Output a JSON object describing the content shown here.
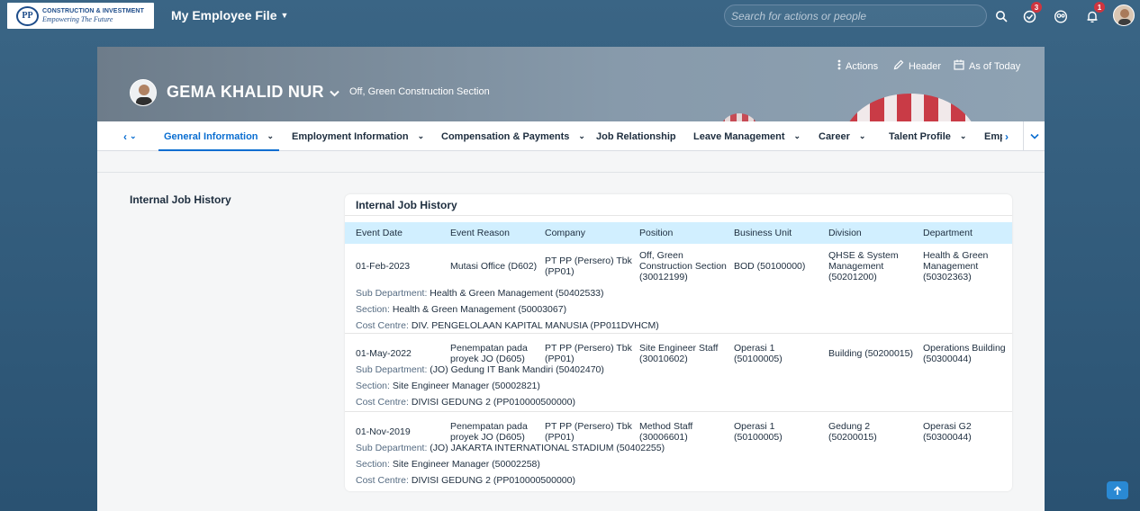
{
  "shell": {
    "logo_line1": "CONSTRUCTION & INVESTMENT",
    "logo_line2": "Empowering The Future",
    "logo_mark": "PP",
    "app_title": "My Employee File",
    "search_placeholder": "Search for actions or people",
    "tasks_badge": "3",
    "notifications_badge": "1"
  },
  "header": {
    "employee_name": "GEMA KHALID NUR",
    "position": "Off, Green Construction Section",
    "actions_label": "Actions",
    "header_label": "Header",
    "as_of_label": "As of Today"
  },
  "tabs": [
    {
      "label": "General Information",
      "active": true
    },
    {
      "label": "Employment Information"
    },
    {
      "label": "Compensation & Payments"
    },
    {
      "label": "Job Relationship"
    },
    {
      "label": "Leave Management"
    },
    {
      "label": "Career"
    },
    {
      "label": "Talent Profile"
    },
    {
      "label": "Emp"
    }
  ],
  "section": {
    "title": "Internal Job History",
    "card_title": "Internal Job History",
    "columns": [
      "Event Date",
      "Event Reason",
      "Company",
      "Position",
      "Business Unit",
      "Division",
      "Department"
    ],
    "sub_labels": {
      "sub_department": "Sub Department:",
      "section": "Section:",
      "cost_centre": "Cost Centre:"
    },
    "rows": [
      {
        "event_date": "01-Feb-2023",
        "event_reason": "Mutasi Office (D602)",
        "company": [
          "PT PP (Persero) Tbk",
          "(PP01)"
        ],
        "position": [
          "Off, Green",
          "Construction Section",
          "(30012199)"
        ],
        "business_unit": [
          "BOD (50100000)"
        ],
        "division": [
          "QHSE & System",
          "Management",
          "(50201200)"
        ],
        "department": [
          "Health & Green",
          "Management",
          "(50302363)"
        ],
        "sub_department": "Health & Green Management (50402533)",
        "section": "Health & Green Management (50003067)",
        "cost_centre": "DIV. PENGELOLAAN KAPITAL MANUSIA (PP011DVHCM)"
      },
      {
        "event_date": "01-May-2022",
        "event_reason": [
          "Penempatan pada",
          "proyek JO (D605)"
        ],
        "company": [
          "PT PP (Persero) Tbk",
          "(PP01)"
        ],
        "position": [
          "Site Engineer Staff",
          "(30010602)"
        ],
        "business_unit": [
          "Operasi 1",
          "(50100005)"
        ],
        "division": [
          "Building (50200015)"
        ],
        "department": [
          "Operations Building",
          "(50300044)"
        ],
        "sub_department": "(JO) Gedung IT Bank Mandiri (50402470)",
        "section": "Site Engineer Manager (50002821)",
        "cost_centre": "DIVISI GEDUNG 2 (PP010000500000)"
      },
      {
        "event_date": "01-Nov-2019",
        "event_reason": [
          "Penempatan pada",
          "proyek JO (D605)"
        ],
        "company": [
          "PT PP (Persero) Tbk",
          "(PP01)"
        ],
        "position": [
          "Method Staff",
          "(30006601)"
        ],
        "business_unit": [
          "Operasi 1",
          "(50100005)"
        ],
        "division": [
          "Gedung 2",
          "(50200015)"
        ],
        "department": [
          "Operasi G2",
          "(50300044)"
        ],
        "sub_department": "(JO) JAKARTA INTERNATIONAL STADIUM (50402255)",
        "section": "Site Engineer Manager (50002258)",
        "cost_centre": "DIVISI GEDUNG 2 (PP010000500000)"
      }
    ]
  },
  "colors": {
    "accent": "#0a6ed1",
    "table_header_bg": "#d1efff",
    "badge": "#d0353f"
  }
}
